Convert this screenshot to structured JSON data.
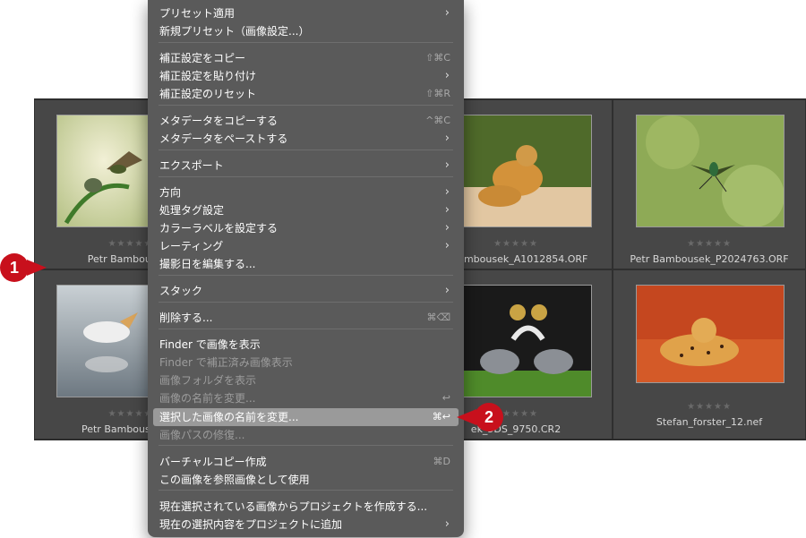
{
  "grid": {
    "cells": [
      {
        "filename": "Petr Bambousek_",
        "stars": "★★★★★"
      },
      {
        "filename": "",
        "stars": "★★★★★"
      },
      {
        "filename": "r Bambousek_A1012854.ORF",
        "stars": "★★★★★"
      },
      {
        "filename": "Petr Bambousek_P2024763.ORF",
        "stars": "★★★★★"
      },
      {
        "filename": "Petr Bambousek_P2",
        "stars": "★★★★★"
      },
      {
        "filename": "",
        "stars": "★★★★★"
      },
      {
        "filename": "ek_5DS_9750.CR2",
        "stars": "★★★★★"
      },
      {
        "filename": "Stefan_forster_12.nef",
        "stars": "★★★★★"
      }
    ]
  },
  "menu": {
    "items": [
      {
        "label": "プリセット適用",
        "shortcut": "",
        "submenu": true,
        "disabled": false
      },
      {
        "label": "新規プリセット（画像設定...）",
        "shortcut": "",
        "submenu": false,
        "disabled": false
      },
      {
        "label": "補正設定をコピー",
        "shortcut": "⇧⌘C",
        "submenu": false,
        "disabled": false
      },
      {
        "label": "補正設定を貼り付け",
        "shortcut": "",
        "submenu": true,
        "disabled": false
      },
      {
        "label": "補正設定のリセット",
        "shortcut": "⇧⌘R",
        "submenu": false,
        "disabled": false
      },
      {
        "label": "メタデータをコピーする",
        "shortcut": "^⌘C",
        "submenu": false,
        "disabled": false
      },
      {
        "label": "メタデータをペーストする",
        "shortcut": "",
        "submenu": true,
        "disabled": false
      },
      {
        "label": "エクスポート",
        "shortcut": "",
        "submenu": true,
        "disabled": false
      },
      {
        "label": "方向",
        "shortcut": "",
        "submenu": true,
        "disabled": false
      },
      {
        "label": "処理タグ設定",
        "shortcut": "",
        "submenu": true,
        "disabled": false
      },
      {
        "label": "カラーラベルを設定する",
        "shortcut": "",
        "submenu": true,
        "disabled": false
      },
      {
        "label": "レーティング",
        "shortcut": "",
        "submenu": true,
        "disabled": false
      },
      {
        "label": "撮影日を編集する...",
        "shortcut": "",
        "submenu": false,
        "disabled": false
      },
      {
        "label": "スタック",
        "shortcut": "",
        "submenu": true,
        "disabled": false
      },
      {
        "label": "削除する...",
        "shortcut": "⌘⌫",
        "submenu": false,
        "disabled": false
      },
      {
        "label": "Finder で画像を表示",
        "shortcut": "",
        "submenu": false,
        "disabled": false
      },
      {
        "label": "Finder で補正済み画像表示",
        "shortcut": "",
        "submenu": false,
        "disabled": true
      },
      {
        "label": "画像フォルダを表示",
        "shortcut": "",
        "submenu": false,
        "disabled": true
      },
      {
        "label": "画像の名前を変更...",
        "shortcut": "↩",
        "submenu": false,
        "disabled": true
      },
      {
        "label": "選択した画像の名前を変更...",
        "shortcut": "⌘↩",
        "submenu": false,
        "disabled": false,
        "selected": true
      },
      {
        "label": "画像パスの修復...",
        "shortcut": "",
        "submenu": false,
        "disabled": true
      },
      {
        "label": "バーチャルコピー作成",
        "shortcut": "⌘D",
        "submenu": false,
        "disabled": false
      },
      {
        "label": "この画像を参照画像として使用",
        "shortcut": "",
        "submenu": false,
        "disabled": false
      },
      {
        "label": "現在選択されている画像からプロジェクトを作成する...",
        "shortcut": "",
        "submenu": false,
        "disabled": false
      },
      {
        "label": "現在の選択内容をプロジェクトに追加",
        "shortcut": "",
        "submenu": true,
        "disabled": false
      }
    ]
  },
  "callouts": {
    "one": "1",
    "two": "2"
  },
  "colors": {
    "accent_callout": "#c8101c",
    "menu_bg": "#5a5a5a",
    "selection": "#9a9a9a"
  }
}
